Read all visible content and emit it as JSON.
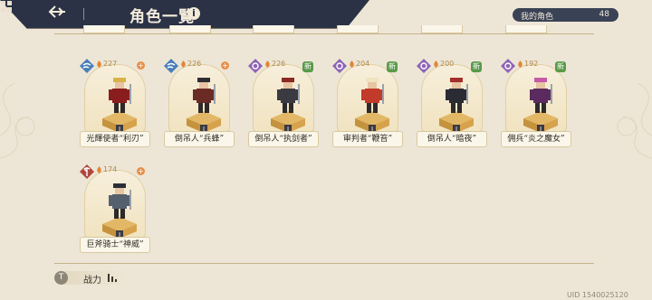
{
  "header": {
    "title": "角色一覧",
    "info_icon": "i",
    "my_characters_label": "我的角色",
    "my_characters_count": "48"
  },
  "characters": [
    {
      "name": "光輝使者“利刃”",
      "power": "227",
      "element": "wind-icon",
      "is_new": false
    },
    {
      "name": "倒吊人“兵蜂”",
      "power": "226",
      "element": "wind-icon",
      "is_new": false
    },
    {
      "name": "倒吊人“执剑者”",
      "power": "226",
      "element": "arcane-icon",
      "is_new": true
    },
    {
      "name": "审判者“鞭笞”",
      "power": "204",
      "element": "arcane-icon",
      "is_new": true
    },
    {
      "name": "倒吊人“暗夜”",
      "power": "200",
      "element": "arcane-icon",
      "is_new": true
    },
    {
      "name": "佣兵“炎之魔女”",
      "power": "192",
      "element": "arcane-icon",
      "is_new": true
    },
    {
      "name": "巨斧骑士“神威”",
      "power": "174",
      "element": "axe-icon",
      "is_new": false
    }
  ],
  "footer": {
    "power_filter_label": "战力",
    "power_filter_key": "T",
    "uid": "UID 1540025120"
  },
  "colors": {
    "background": "#ede6d6",
    "header": "#2b3245",
    "wind": "#4a7fb8",
    "arcane": "#8d64b5",
    "axe": "#b0463e"
  }
}
